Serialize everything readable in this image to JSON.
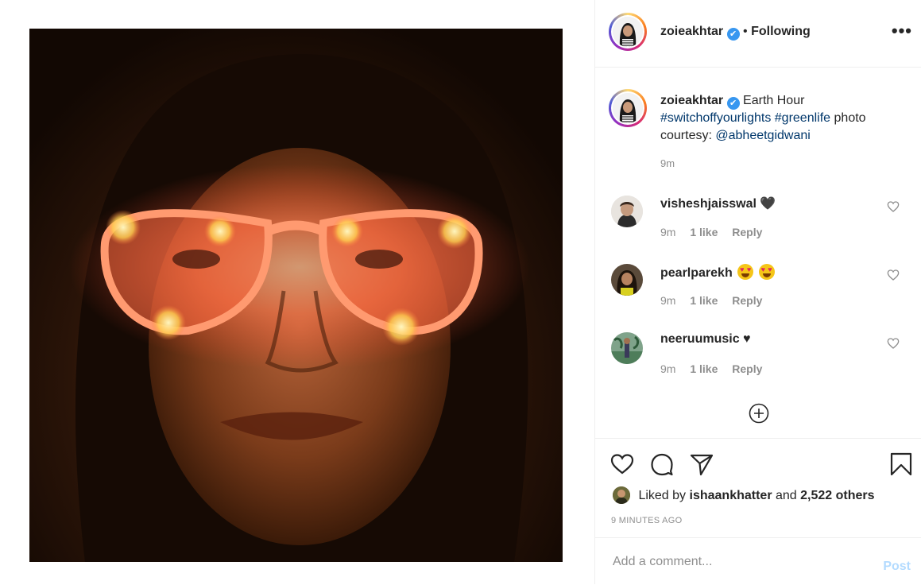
{
  "post": {
    "author": "zoieakhtar",
    "verified_mark": "✔",
    "separator": "•",
    "follow_status": "Following",
    "more_label": "•••"
  },
  "caption": {
    "author": "zoieakhtar",
    "text": "Earth Hour",
    "hashtag1": "#switchoffyourlights",
    "hashtag2": "#greenlife",
    "suffix": "photo courtesy:",
    "mention": "@abheetgidwani",
    "time": "9m"
  },
  "comments": [
    {
      "user": "visheshjaisswal",
      "text": "🖤",
      "time": "9m",
      "likes": "1 like",
      "reply": "Reply"
    },
    {
      "user": "pearlparekh",
      "text": "",
      "emoji_count": 2,
      "time": "9m",
      "likes": "1 like",
      "reply": "Reply"
    },
    {
      "user": "neeruumusic",
      "text": "♥",
      "time": "9m",
      "likes": "1 like",
      "reply": "Reply"
    }
  ],
  "likes": {
    "prefix": "Liked by",
    "user": "ishaankhatter",
    "and": "and",
    "count": "2,522 others"
  },
  "timestamp": "9 MINUTES AGO",
  "comment_box": {
    "placeholder": "Add a comment...",
    "post_label": "Post"
  },
  "icons": {
    "like": "heart-icon",
    "comment": "comment-bubble-icon",
    "share": "paper-plane-icon",
    "save": "bookmark-icon",
    "load_more": "plus-circle-icon"
  },
  "colors": {
    "link": "#00376b",
    "verified": "#3897f0",
    "muted": "#8e8e8e",
    "post_button": "#b3dbff"
  }
}
